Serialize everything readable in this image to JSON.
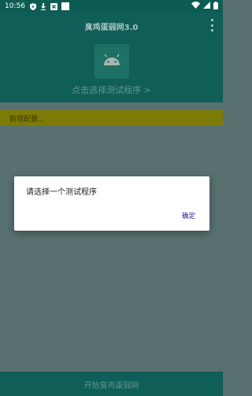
{
  "status_bar": {
    "time": "10:56",
    "left_icons": [
      "shield-icon",
      "download-icon",
      "x-box-icon",
      "white-square-icon"
    ],
    "right_icons": [
      "wifi-icon",
      "signal-icon",
      "battery-icon"
    ]
  },
  "app_bar": {
    "title": "臭鸡蛋弱网3.0",
    "menu_icon": "more-vertical-icon"
  },
  "header": {
    "app_icon": "android-icon",
    "select_label": "点击选择测试程序 >"
  },
  "config_bar": {
    "label": "新增配置..."
  },
  "bottom_bar": {
    "label": "开始臭鸡蛋弱网"
  },
  "dialog": {
    "message": "请选择一个测试程序",
    "confirm_label": "确定"
  },
  "colors": {
    "primary": "#0f5e57",
    "scrim_bg": "#58706f",
    "config_bar": "#7d7b05",
    "dialog_button": "#1f1f8f"
  }
}
